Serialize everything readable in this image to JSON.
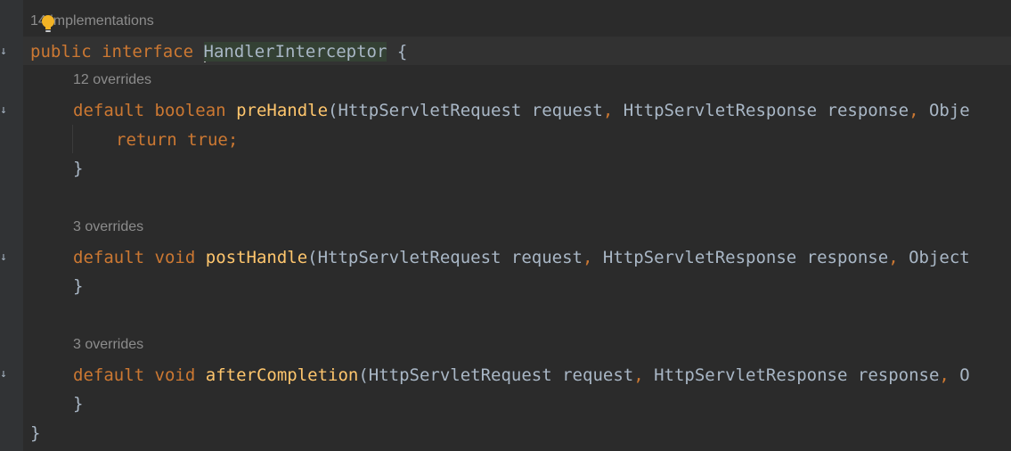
{
  "editor": {
    "implementations_hint": "14 implementations",
    "header": {
      "kw_public": "public",
      "kw_interface": "interface",
      "name": "HandlerInterceptor",
      "brace": "{"
    },
    "methods": [
      {
        "overrides": "12 overrides",
        "kw_default": "default",
        "ret": "boolean",
        "name": "preHandle",
        "params_1": "(HttpServletRequest request",
        "comma_1": ",",
        "params_2": " HttpServletResponse response",
        "comma_2": ",",
        "params_3": " Obje",
        "body_kw_return": "return",
        "body_kw_true": "true",
        "body_semi": ";",
        "close": "}"
      },
      {
        "overrides": "3 overrides",
        "kw_default": "default",
        "ret": "void",
        "name": "postHandle",
        "params_1": "(HttpServletRequest request",
        "comma_1": ",",
        "params_2": " HttpServletResponse response",
        "comma_2": ",",
        "params_3": " Object",
        "close": "}"
      },
      {
        "overrides": "3 overrides",
        "kw_default": "default",
        "ret": "void",
        "name": "afterCompletion",
        "params_1": "(HttpServletRequest request",
        "comma_1": ",",
        "params_2": " HttpServletResponse response",
        "comma_2": ",",
        "params_3": " O",
        "close": "}"
      }
    ],
    "final_brace": "}"
  },
  "colors": {
    "background": "#2b2b2b",
    "keyword": "#cc7832",
    "function": "#ffc66d",
    "text": "#a9b7c6",
    "hint": "#8c8c8c"
  },
  "icons": [
    "lightbulb-icon",
    "gutter-implemented-icon"
  ]
}
